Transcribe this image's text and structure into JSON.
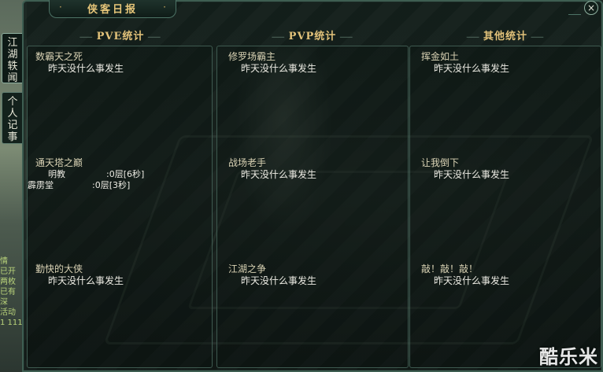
{
  "window": {
    "title": "侠客日报",
    "close_label": "×"
  },
  "side_tabs": [
    {
      "label": "江湖轶闻"
    },
    {
      "label": "个人记事"
    }
  ],
  "chat_lines": [
    "情",
    "已开",
    "两枚",
    "已有",
    "深",
    "活动",
    "1 111"
  ],
  "columns": [
    {
      "header": "PVE统计",
      "entries": [
        {
          "title": "数霸天之死",
          "value": "昨天没什么事发生"
        },
        {
          "title": "通天塔之巅",
          "records": [
            {
              "label": "明教",
              "value": ":0层[6秒]"
            },
            {
              "label": "霹雳堂",
              "value": ":0层[3秒]"
            }
          ]
        },
        {
          "title": "勤快的大侠",
          "value": "昨天没什么事发生"
        }
      ]
    },
    {
      "header": "PVP统计",
      "entries": [
        {
          "title": "修罗场霸主",
          "value": "昨天没什么事发生"
        },
        {
          "title": "战场老手",
          "value": "昨天没什么事发生"
        },
        {
          "title": "江湖之争",
          "value": "昨天没什么事发生"
        }
      ]
    },
    {
      "header": "其他统计",
      "entries": [
        {
          "title": "挥金如土",
          "value": "昨天没什么事发生"
        },
        {
          "title": "让我倒下",
          "value": "昨天没什么事发生"
        },
        {
          "title": "敲！敲！敲！",
          "value": "昨天没什么事发生"
        }
      ]
    }
  ],
  "watermark": "酷乐米"
}
